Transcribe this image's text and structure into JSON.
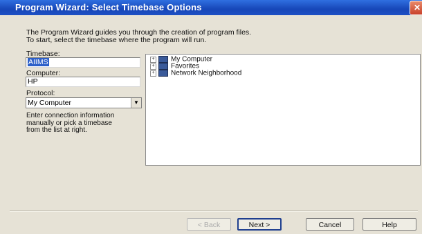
{
  "window": {
    "title": "Program Wizard: Select Timebase Options",
    "close_glyph": "✕"
  },
  "intro": {
    "line1": "The Program Wizard guides you through the creation of program files.",
    "line2": "To start, select the timebase where the program will run."
  },
  "timebase": {
    "label": "Timebase:",
    "value": "AIIMS"
  },
  "computer": {
    "label": "Computer:",
    "value": "HP"
  },
  "protocol": {
    "label": "Protocol:",
    "value": "My Computer"
  },
  "help": {
    "line1": "Enter connection information",
    "line2": "manually or pick a timebase",
    "line3": "from the list at right."
  },
  "tree": {
    "items": [
      {
        "label": "My Computer",
        "icon": "computer-icon"
      },
      {
        "label": "Favorites",
        "icon": "favorites-icon"
      },
      {
        "label": "Network Neighborhood",
        "icon": "network-icon"
      }
    ]
  },
  "buttons": {
    "back": "< Back",
    "next": "Next >",
    "cancel": "Cancel",
    "help": "Help"
  }
}
